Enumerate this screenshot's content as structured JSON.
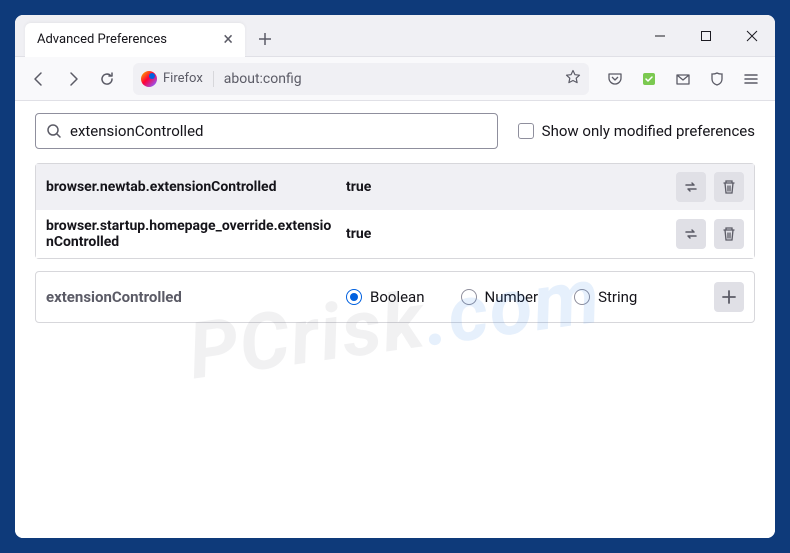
{
  "window": {
    "tab_title": "Advanced Preferences",
    "url_label": "Firefox",
    "url": "about:config"
  },
  "search": {
    "value": "extensionControlled",
    "show_modified_label": "Show only modified preferences"
  },
  "prefs": [
    {
      "name": "browser.newtab.extensionControlled",
      "value": "true"
    },
    {
      "name": "browser.startup.homepage_override.extensionControlled",
      "value": "true"
    }
  ],
  "new_pref": {
    "name": "extensionControlled",
    "types": {
      "boolean": "Boolean",
      "number": "Number",
      "string": "String"
    }
  },
  "watermark": {
    "a": "PCrisk",
    "b": ".com"
  }
}
